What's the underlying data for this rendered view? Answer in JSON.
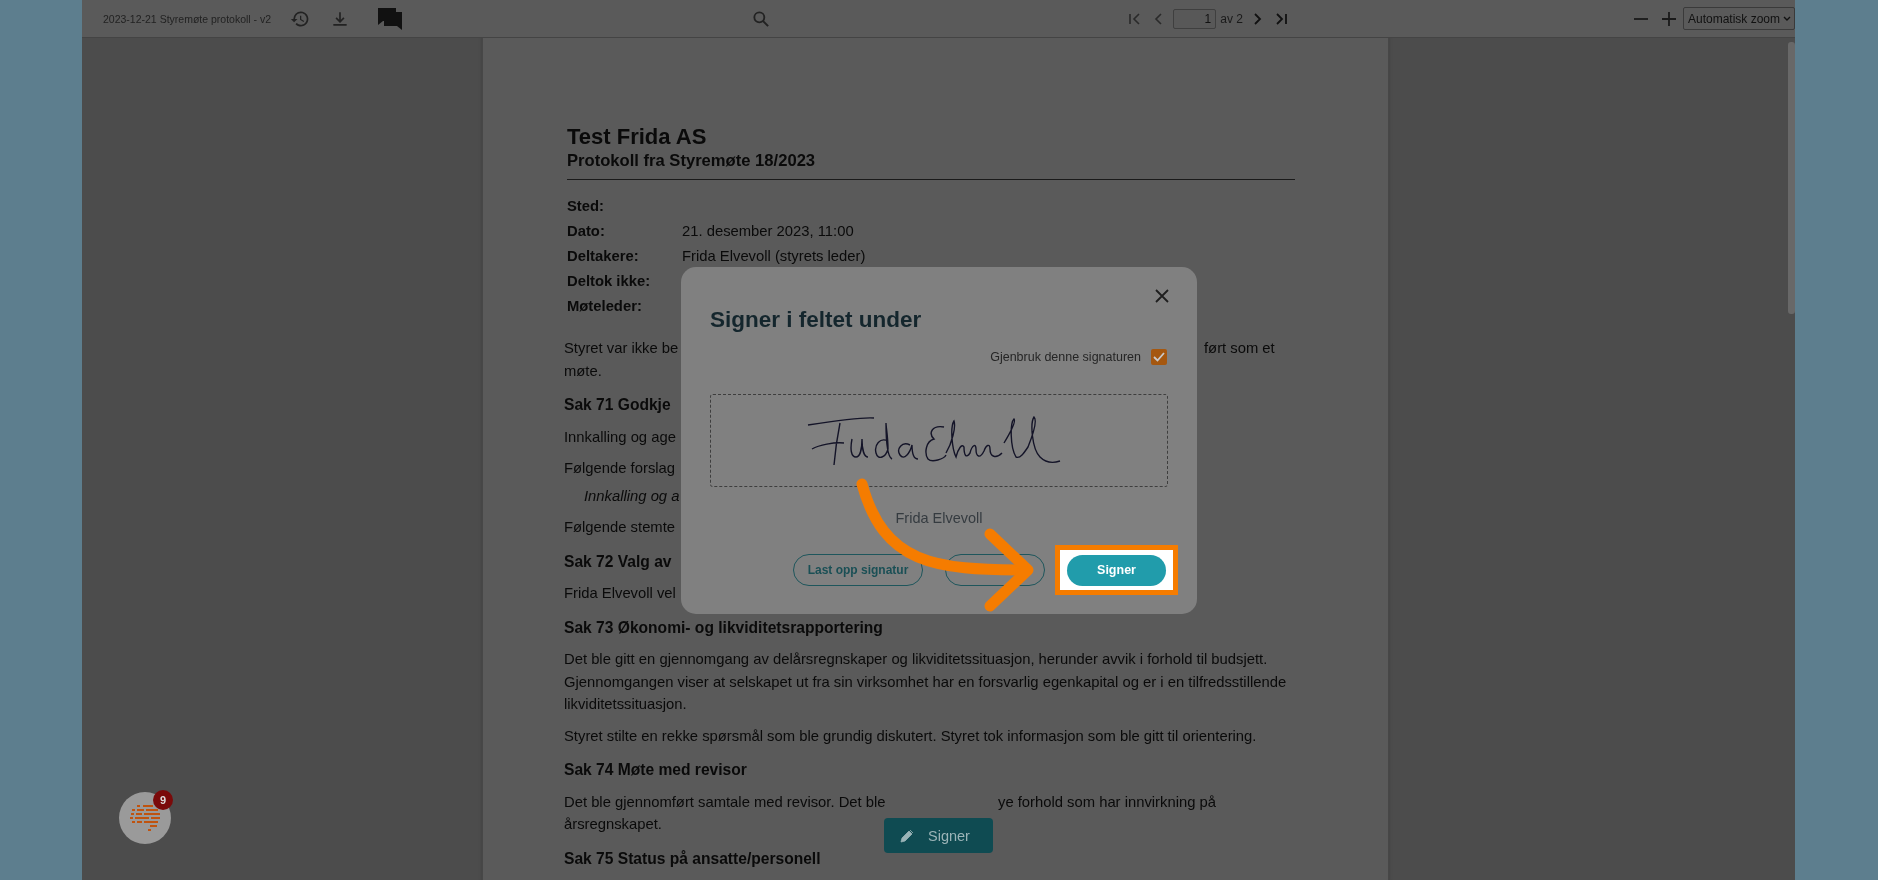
{
  "toolbar": {
    "document_title": "2023-12-21 Styremøte protokoll - v2",
    "page_number": "1",
    "page_count": "av 2",
    "zoom": "Automatisk zoom"
  },
  "document": {
    "company": "Test Frida AS",
    "subtitle": "Protokoll fra Styremøte 18/2023",
    "meta": [
      {
        "label": "Sted:"
      },
      {
        "label": "Dato:",
        "value": "21. desember 2023, 11:00"
      },
      {
        "label": "Deltakere:",
        "value": "Frida Elvevoll (styrets leder)"
      },
      {
        "label": "Deltok ikke:"
      },
      {
        "label": "Møteleder:"
      }
    ],
    "lines": [
      {
        "kind": "dialog-split",
        "text": "Styret var ikke be",
        "right": "ført som et"
      },
      {
        "kind": "continuation",
        "text": "møte."
      },
      {
        "kind": "heading",
        "text": "Sak 71 Godkje"
      },
      {
        "kind": "text",
        "text": "Innkalling og age"
      },
      {
        "kind": "text",
        "text": "Følgende forslag"
      },
      {
        "kind": "italic",
        "text": "Innkalling og a"
      },
      {
        "kind": "text",
        "text": "Følgende stemte"
      },
      {
        "kind": "heading",
        "text": "Sak 72 Valg av"
      },
      {
        "kind": "text",
        "text": "Frida Elvevoll vel"
      },
      {
        "kind": "heading",
        "text": "Sak 73 Økonomi- og likviditetsrapportering"
      },
      {
        "kind": "text",
        "text": "Det ble gitt en gjennomgang av delårsregnskaper og likviditetssituasjon, herunder avvik i forhold til budsjett."
      },
      {
        "kind": "continuation",
        "text": "Gjennomgangen viser at selskapet ut fra sin virksomhet har en forsvarlig egenkapital og er i en tilfredsstillende"
      },
      {
        "kind": "continuation",
        "text": "likviditetssituasjon."
      },
      {
        "kind": "text",
        "text": "Styret stilte en rekke spørsmål som ble grundig diskutert. Styret tok informasjon som ble gitt til orientering."
      },
      {
        "kind": "heading",
        "text": "Sak 74 Møte med revisor"
      },
      {
        "kind": "button-split",
        "text": "Det ble gjennomført samtale med revisor. Det ble",
        "right": "ye forhold som har innvirkning på"
      },
      {
        "kind": "continuation",
        "text": "årsregnskapet."
      },
      {
        "kind": "heading",
        "text": "Sak 75 Status på ansatte/personell"
      }
    ]
  },
  "dialog": {
    "title": "Signer i feltet under",
    "reuse_signature": {
      "label": "Gjenbruk denne signaturen",
      "checked": true
    },
    "signer_name": "Frida Elvevoll",
    "upload_button": "Last opp signatur",
    "sign_button": "Signer"
  },
  "sign_fab": {
    "label": "Signer"
  },
  "chat_launcher": {
    "badge": "9"
  }
}
